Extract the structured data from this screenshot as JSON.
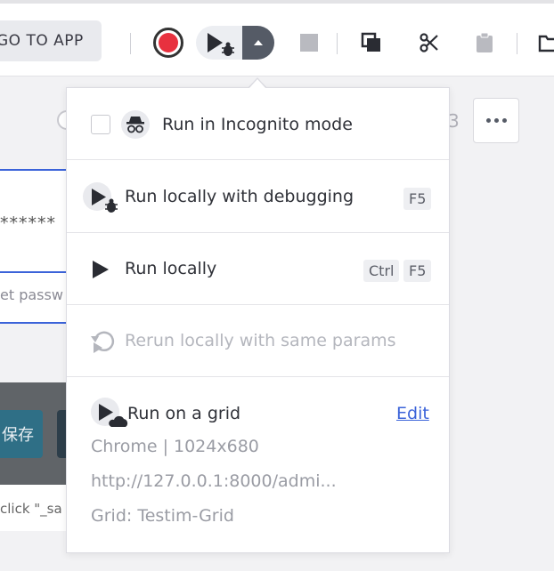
{
  "toolbar": {
    "goto_app_label": "GO TO APP"
  },
  "background": {
    "page_number": "3",
    "password_mask": "******",
    "password_hint": "et passw",
    "save_label": "保存",
    "click_hint": "click \"_sa"
  },
  "menu": {
    "incognito_label": "Run in Incognito mode",
    "debug_label": "Run locally with debugging",
    "debug_shortcut": "F5",
    "local_label": "Run locally",
    "local_shortcut_mod": "Ctrl",
    "local_shortcut_key": "F5",
    "rerun_label": "Rerun locally with same params",
    "grid_label": "Run on a grid",
    "grid_edit": "Edit",
    "grid_browser": "Chrome | 1024x680",
    "grid_url": "http://127.0.0.1:8000/admi...",
    "grid_name": "Grid: Testim-Grid"
  },
  "colors": {
    "record_red": "#e8313f",
    "link_blue": "#3b63d9",
    "dark_button": "#555b66"
  }
}
